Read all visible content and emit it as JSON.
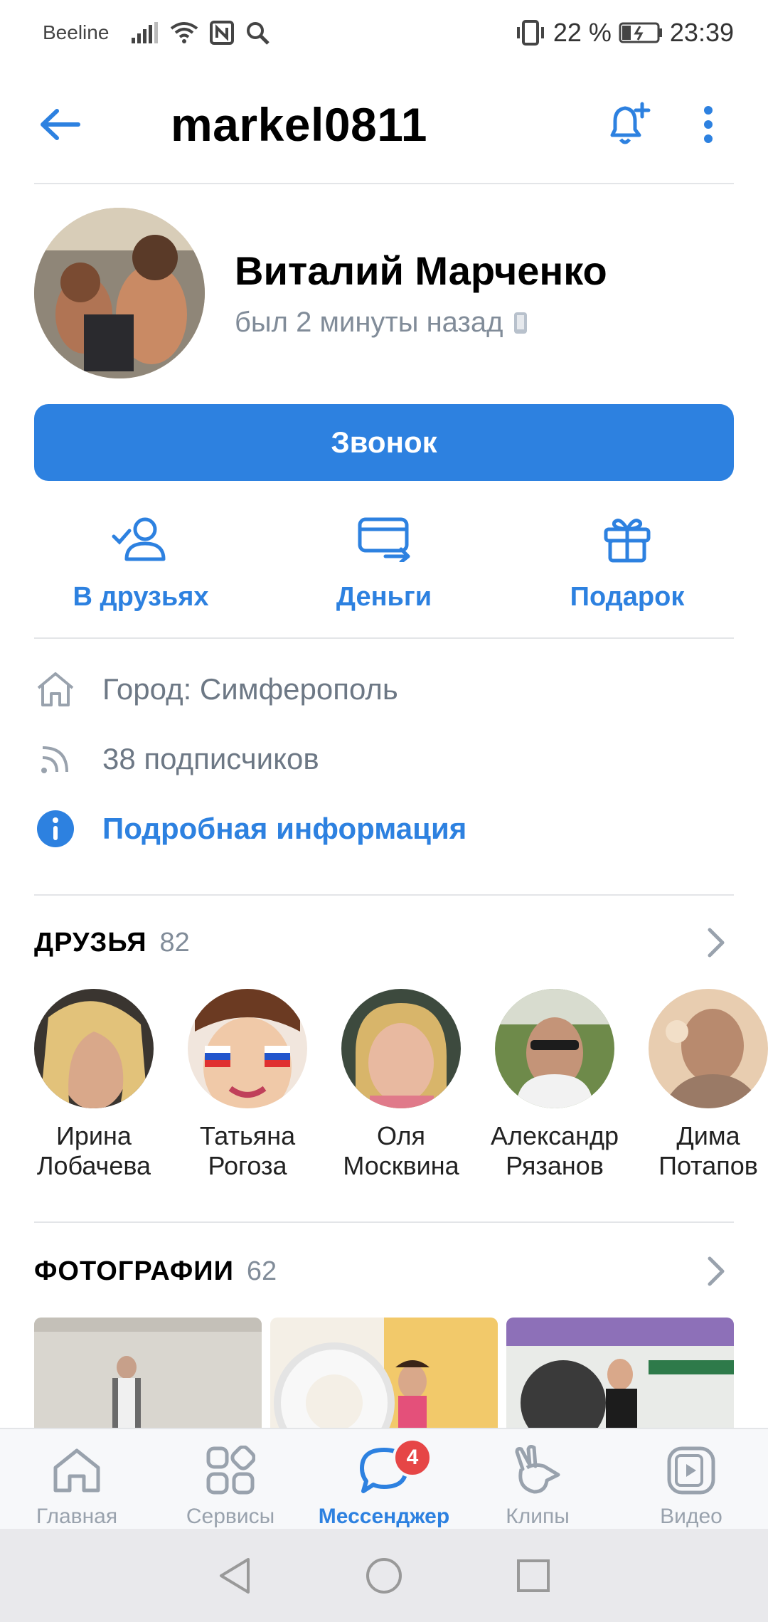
{
  "status_bar": {
    "carrier": "Beeline",
    "battery": "22 %",
    "time": "23:39"
  },
  "header": {
    "title": "markel0811"
  },
  "profile": {
    "name": "Виталий Марченко",
    "last_seen": "был 2 минуты назад"
  },
  "call_button": "Звонок",
  "actions": [
    {
      "label": "В друзьях",
      "icon": "user-check-icon"
    },
    {
      "label": "Деньги",
      "icon": "money-transfer-icon"
    },
    {
      "label": "Подарок",
      "icon": "gift-icon"
    }
  ],
  "details": {
    "city": "Город: Симферополь",
    "followers": "38 подписчиков",
    "more_info": "Подробная информация"
  },
  "friends": {
    "title": "ДРУЗЬЯ",
    "count": "82",
    "items": [
      {
        "first": "Ирина",
        "last": "Лобачева"
      },
      {
        "first": "Татьяна",
        "last": "Рогоза"
      },
      {
        "first": "Оля",
        "last": "Москвина"
      },
      {
        "first": "Александр",
        "last": "Рязанов"
      },
      {
        "first": "Дима",
        "last": "Потапов"
      }
    ]
  },
  "photos": {
    "title": "ФОТОГРАФИИ",
    "count": "62"
  },
  "tabbar": {
    "items": [
      {
        "label": "Главная",
        "icon": "home-icon"
      },
      {
        "label": "Сервисы",
        "icon": "services-icon"
      },
      {
        "label": "Мессенджер",
        "icon": "messenger-icon",
        "badge": "4",
        "active": true
      },
      {
        "label": "Клипы",
        "icon": "clips-icon"
      },
      {
        "label": "Видео",
        "icon": "video-icon"
      }
    ]
  },
  "colors": {
    "accent": "#2d81e0",
    "secondary_text": "#818c99",
    "badge": "#e64646"
  }
}
